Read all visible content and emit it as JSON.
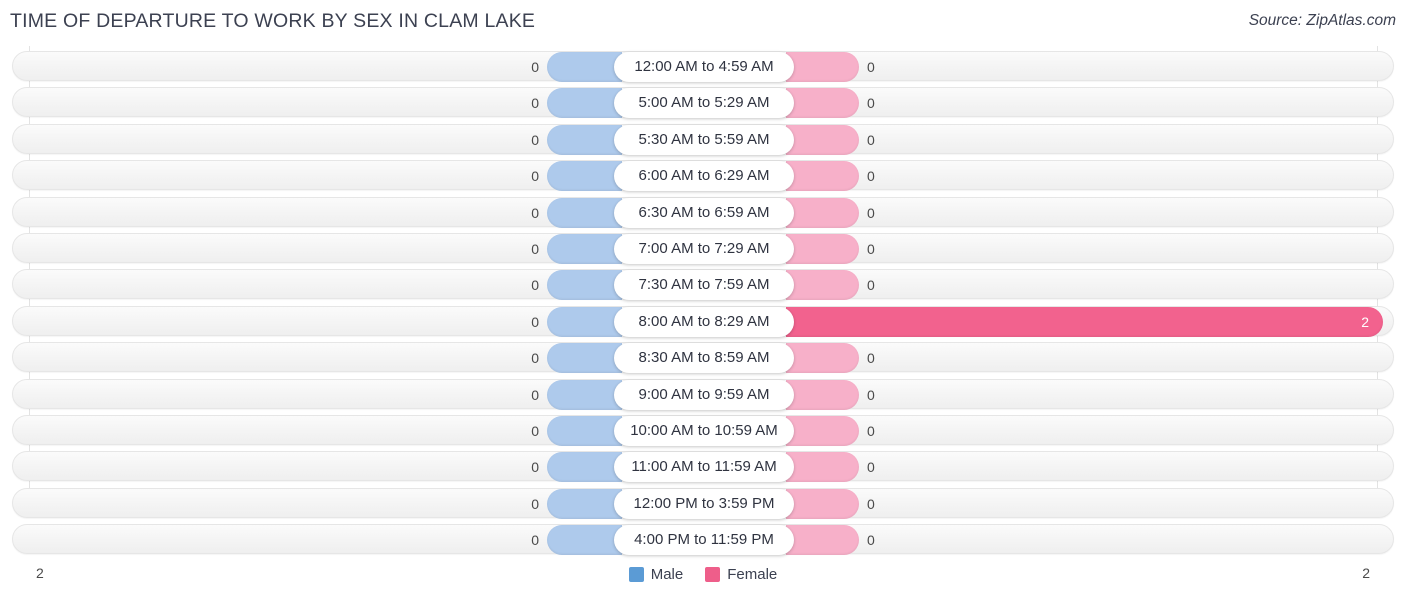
{
  "header": {
    "title": "TIME OF DEPARTURE TO WORK BY SEX IN CLAM LAKE",
    "source": "Source: ZipAtlas.com"
  },
  "legend": {
    "male": {
      "label": "Male",
      "color": "#5b9bd5"
    },
    "female": {
      "label": "Female",
      "color": "#ee5e8a"
    }
  },
  "axis": {
    "left_label": "2",
    "right_label": "2"
  },
  "colors": {
    "male_bar": "#aecaec",
    "female_bar": "#f7b0c9",
    "female_bar_highlight": "#f2628e",
    "row_background": "#f4f4f4",
    "row_border": "#e6e6e6",
    "title_text": "#3c4151"
  },
  "chart_data": {
    "type": "bar",
    "title": "TIME OF DEPARTURE TO WORK BY SEX IN CLAM LAKE",
    "subtitle": "Source: ZipAtlas.com",
    "orientation": "horizontal-diverging",
    "xlabel": "",
    "ylabel": "",
    "xlim": [
      2,
      2
    ],
    "grid": false,
    "legend_position": "bottom-center",
    "categories": [
      "12:00 AM to 4:59 AM",
      "5:00 AM to 5:29 AM",
      "5:30 AM to 5:59 AM",
      "6:00 AM to 6:29 AM",
      "6:30 AM to 6:59 AM",
      "7:00 AM to 7:29 AM",
      "7:30 AM to 7:59 AM",
      "8:00 AM to 8:29 AM",
      "8:30 AM to 8:59 AM",
      "9:00 AM to 9:59 AM",
      "10:00 AM to 10:59 AM",
      "11:00 AM to 11:59 AM",
      "12:00 PM to 3:59 PM",
      "4:00 PM to 11:59 PM"
    ],
    "series": [
      {
        "name": "Male",
        "color": "#5b9bd5",
        "values": [
          0,
          0,
          0,
          0,
          0,
          0,
          0,
          0,
          0,
          0,
          0,
          0,
          0,
          0
        ]
      },
      {
        "name": "Female",
        "color": "#ee5e8a",
        "values": [
          0,
          0,
          0,
          0,
          0,
          0,
          0,
          2,
          0,
          0,
          0,
          0,
          0,
          0
        ]
      }
    ]
  },
  "rows": [
    {
      "label": "12:00 AM to 4:59 AM",
      "male": "0",
      "female": "0",
      "highlight": false
    },
    {
      "label": "5:00 AM to 5:29 AM",
      "male": "0",
      "female": "0",
      "highlight": false
    },
    {
      "label": "5:30 AM to 5:59 AM",
      "male": "0",
      "female": "0",
      "highlight": false
    },
    {
      "label": "6:00 AM to 6:29 AM",
      "male": "0",
      "female": "0",
      "highlight": false
    },
    {
      "label": "6:30 AM to 6:59 AM",
      "male": "0",
      "female": "0",
      "highlight": false
    },
    {
      "label": "7:00 AM to 7:29 AM",
      "male": "0",
      "female": "0",
      "highlight": false
    },
    {
      "label": "7:30 AM to 7:59 AM",
      "male": "0",
      "female": "0",
      "highlight": false
    },
    {
      "label": "8:00 AM to 8:29 AM",
      "male": "0",
      "female": "2",
      "highlight": true
    },
    {
      "label": "8:30 AM to 8:59 AM",
      "male": "0",
      "female": "0",
      "highlight": false
    },
    {
      "label": "9:00 AM to 9:59 AM",
      "male": "0",
      "female": "0",
      "highlight": false
    },
    {
      "label": "10:00 AM to 10:59 AM",
      "male": "0",
      "female": "0",
      "highlight": false
    },
    {
      "label": "11:00 AM to 11:59 AM",
      "male": "0",
      "female": "0",
      "highlight": false
    },
    {
      "label": "12:00 PM to 3:59 PM",
      "male": "0",
      "female": "0",
      "highlight": false
    },
    {
      "label": "4:00 PM to 11:59 PM",
      "male": "0",
      "female": "0",
      "highlight": false
    }
  ]
}
